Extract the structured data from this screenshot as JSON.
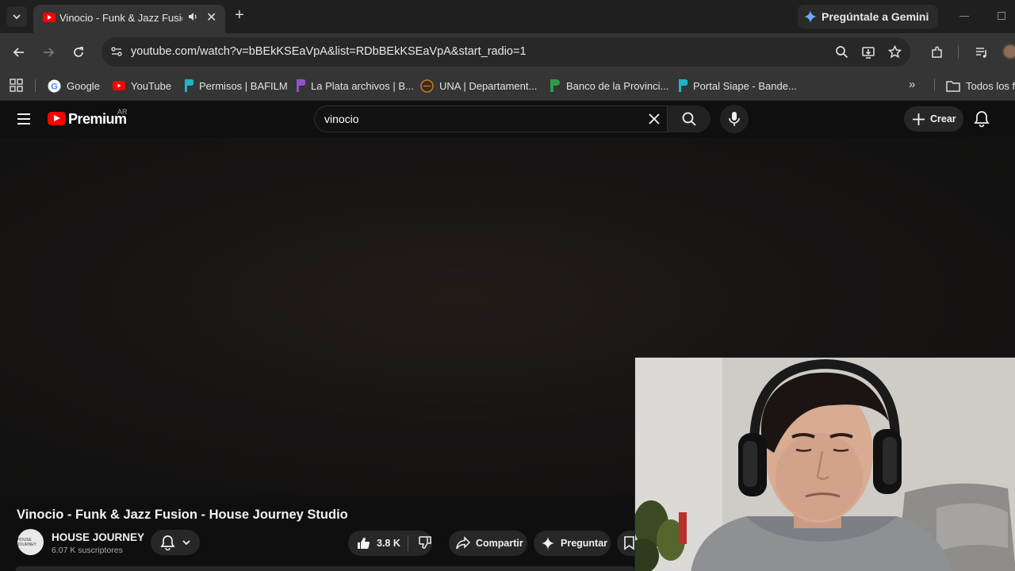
{
  "browser": {
    "tab": {
      "title": "Vinocio - Funk & Jazz Fusion"
    },
    "gemini_label": "Pregúntale a Gemini",
    "url": "youtube.com/watch?v=bBEkKSEaVpA&list=RDbBEkKSEaVpA&start_radio=1",
    "bookmarks": [
      {
        "label": "Google",
        "color": "#4285f4"
      },
      {
        "label": "YouTube",
        "color": "#ff0000"
      },
      {
        "label": "Permisos | BAFILM",
        "color": "#1fb3c7"
      },
      {
        "label": "La Plata archivos | B...",
        "color": "#8e55c9"
      },
      {
        "label": "UNA | Departament...",
        "color": "#c07a2a"
      },
      {
        "label": "Banco de la Provinci...",
        "color": "#2e9b45"
      },
      {
        "label": "Portal Siape - Bande...",
        "color": "#1fb3c7"
      }
    ],
    "all_bookmarks_label": "Todos los fa"
  },
  "youtube": {
    "brand": "Premium",
    "country": "AR",
    "search_value": "vinocio",
    "create_label": "Crear"
  },
  "video": {
    "title": "Vinocio - Funk & Jazz Fusion - House Journey Studio",
    "channel": {
      "name": "HOUSE JOURNEY",
      "subscribers": "6.07 K suscriptores",
      "avatar_text": "HOUSE JOURNEY"
    },
    "likes": "3.8 K",
    "share_label": "Compartir",
    "ask_label": "Preguntar"
  },
  "colors": {
    "brand_red": "#ff0000",
    "page_bg": "#0f0f0f",
    "chip_bg": "#272727"
  }
}
